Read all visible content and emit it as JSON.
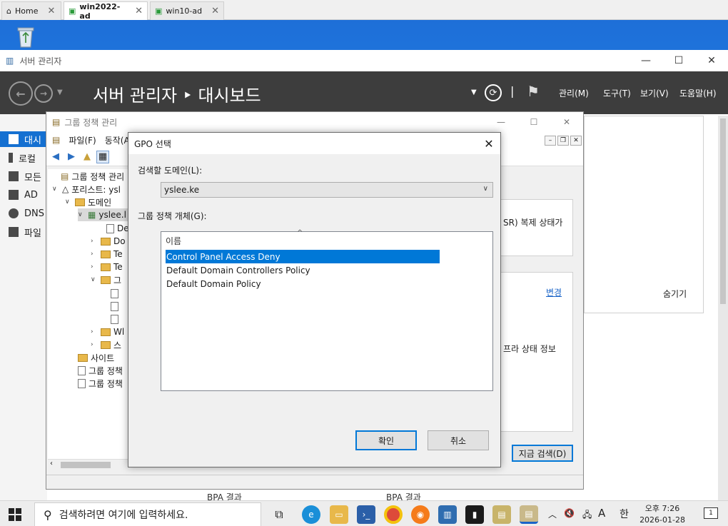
{
  "browser": {
    "tabs": [
      {
        "label": "Home",
        "active": false
      },
      {
        "label": "win2022-ad",
        "active": true
      },
      {
        "label": "win10-ad",
        "active": false
      }
    ]
  },
  "server_manager": {
    "window_title": "서버 관리자",
    "breadcrumb": "서버 관리자 ‣ 대시보드",
    "menus": [
      "관리(M)",
      "도구(T)",
      "보기(V)",
      "도움말(H)"
    ],
    "sidebar": [
      "대시",
      "로컬",
      "모든",
      "AD",
      "DNS",
      "파일"
    ],
    "hide_label": "숨기기",
    "bpa_label_1": "BPA 결과",
    "bpa_label_2": "BPA 결과"
  },
  "gpmc": {
    "title": "그룹 정책 관리",
    "menus": [
      "파일(F)",
      "동작(A"
    ],
    "tree": {
      "root": "그룹 정책 관리",
      "forest": "포리스트: ysl",
      "domains": "도메인",
      "domain": "yslee.l",
      "children": [
        "De",
        "Do",
        "Te",
        "Te",
        "그"
      ],
      "sub_docs": [
        "",
        "",
        ""
      ],
      "wmi": "Wl",
      "starter": "스",
      "sites": "사이트",
      "model": "그룹 정책",
      "results": "그룹 정책"
    },
    "right_pane": {
      "replication_text": "SR) 복제 상태가",
      "change_link": "변경",
      "infra_text": "프라 상태 정보",
      "search_button": "지금 검색(D)"
    }
  },
  "dialog": {
    "title": "GPO 선택",
    "domain_label": "검색할 도메인(L):",
    "domain_value": "yslee.ke",
    "objects_label": "그룹 정책 개체(G):",
    "column_header": "이름",
    "items": [
      {
        "name": "Control Panel Access Deny",
        "selected": true
      },
      {
        "name": "Default Domain Controllers Policy",
        "selected": false
      },
      {
        "name": "Default Domain Policy",
        "selected": false
      }
    ],
    "ok_label": "확인",
    "cancel_label": "취소"
  },
  "taskbar": {
    "search_placeholder": "검색하려면 여기에 입력하세요.",
    "ime": "A",
    "lang": "한",
    "time": "오후 7:26",
    "date": "2026-01-28",
    "notification_count": "1"
  }
}
